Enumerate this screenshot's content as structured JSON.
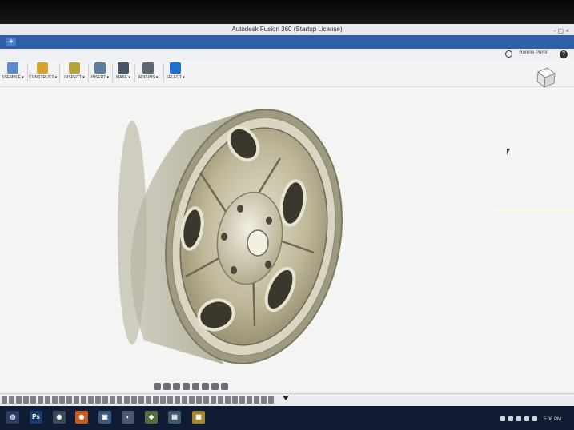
{
  "window": {
    "title": "Autodesk Fusion 360 (Startup License)",
    "controls": "- ▢ ×"
  },
  "tabs": {
    "add_label": "+"
  },
  "user": {
    "name": "Ronnie Perrin",
    "help": "?"
  },
  "toolbar": {
    "items": [
      {
        "label": "SSEMBLE ▾",
        "color": "#5b8ec9"
      },
      {
        "label": "CONSTRUCT ▾",
        "color": "#d6a32b"
      },
      {
        "label": "INSPECT ▾",
        "color": "#b7a33d"
      },
      {
        "label": "INSERT ▾",
        "color": "#5e7e9e"
      },
      {
        "label": "MAKE ▾",
        "color": "#4a5563"
      },
      {
        "label": "ADD-INS ▾",
        "color": "#5d6670"
      },
      {
        "label": "SELECT ▾",
        "color": "#1f6fd0"
      }
    ]
  },
  "taskbar": {
    "time": "5:06 PM",
    "apps": [
      {
        "name": "start",
        "glyph": "◎",
        "color": "#2a3f63"
      },
      {
        "name": "photoshop",
        "glyph": "Ps",
        "color": "#1b3b6d"
      },
      {
        "name": "chrome",
        "glyph": "◉",
        "color": "#3a4a5a"
      },
      {
        "name": "firefox",
        "glyph": "◉",
        "color": "#c65a1f"
      },
      {
        "name": "app5",
        "glyph": "▣",
        "color": "#3c5a7e"
      },
      {
        "name": "app6",
        "glyph": "◐",
        "color": "#4a5a6a"
      },
      {
        "name": "app7",
        "glyph": "◆",
        "color": "#5a6a40"
      },
      {
        "name": "app8",
        "glyph": "▤",
        "color": "#405a6a"
      },
      {
        "name": "app9",
        "glyph": "▦",
        "color": "#a08a30"
      }
    ]
  }
}
